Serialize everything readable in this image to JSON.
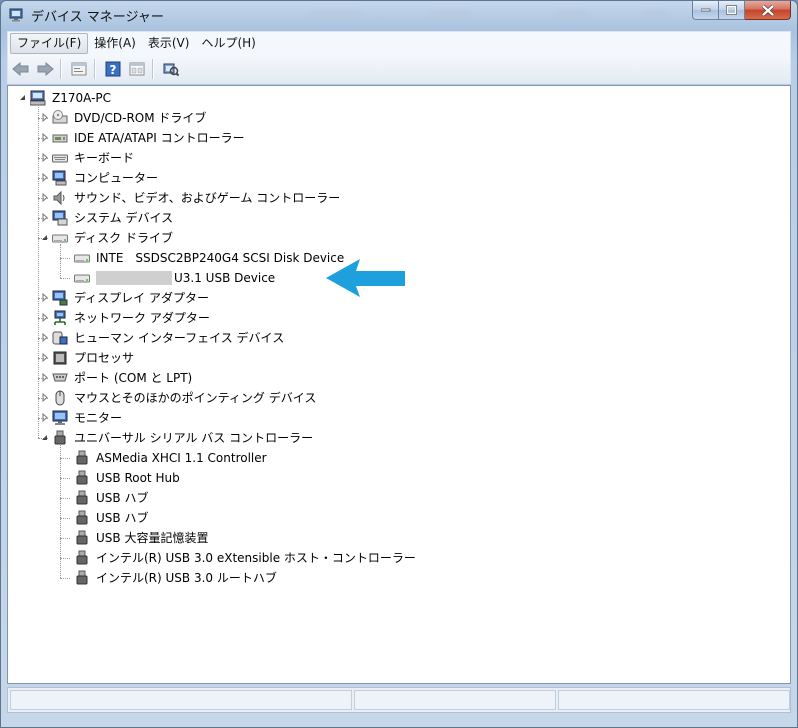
{
  "window": {
    "title": "デバイス マネージャー"
  },
  "menu": [
    {
      "label": "ファイル(F)",
      "name": "menu-file",
      "active": true
    },
    {
      "label": "操作(A)",
      "name": "menu-action"
    },
    {
      "label": "表示(V)",
      "name": "menu-view"
    },
    {
      "label": "ヘルプ(H)",
      "name": "menu-help"
    }
  ],
  "toolbar": [
    "back-icon",
    "forward-icon",
    "properties-icon",
    "help-icon",
    "show-hide-icon",
    "scan-hardware-icon"
  ],
  "tree": {
    "root": "Z170A-PC",
    "categories": [
      {
        "label": "DVD/CD-ROM ドライブ",
        "icon": "dvd-drive-icon",
        "expanded": false
      },
      {
        "label": "IDE ATA/ATAPI コントローラー",
        "icon": "ide-controller-icon",
        "expanded": false
      },
      {
        "label": "キーボード",
        "icon": "keyboard-icon",
        "expanded": false
      },
      {
        "label": "コンピューター",
        "icon": "computer-icon",
        "expanded": false
      },
      {
        "label": "サウンド、ビデオ、およびゲーム コントローラー",
        "icon": "sound-icon",
        "expanded": false
      },
      {
        "label": "システム デバイス",
        "icon": "system-device-icon",
        "expanded": false
      },
      {
        "label": "ディスク ドライブ",
        "icon": "disk-drive-icon",
        "expanded": true,
        "children": [
          {
            "label": "INTE　SSDSC2BP240G4 SCSI Disk Device",
            "icon": "disk-drive-icon"
          },
          {
            "label": "U3.1 USB Device",
            "icon": "disk-drive-icon",
            "redacted": true
          }
        ]
      },
      {
        "label": "ディスプレイ アダプター",
        "icon": "display-adapter-icon",
        "expanded": false
      },
      {
        "label": "ネットワーク アダプター",
        "icon": "network-adapter-icon",
        "expanded": false
      },
      {
        "label": "ヒューマン インターフェイス デバイス",
        "icon": "hid-icon",
        "expanded": false
      },
      {
        "label": "プロセッサ",
        "icon": "processor-icon",
        "expanded": false
      },
      {
        "label": "ポート (COM と LPT)",
        "icon": "port-icon",
        "expanded": false
      },
      {
        "label": "マウスとそのほかのポインティング デバイス",
        "icon": "mouse-icon",
        "expanded": false
      },
      {
        "label": "モニター",
        "icon": "monitor-icon",
        "expanded": false
      },
      {
        "label": "ユニバーサル シリアル バス コントローラー",
        "icon": "usb-controller-icon",
        "expanded": true,
        "children": [
          {
            "label": "ASMedia XHCI 1.1 Controller",
            "icon": "usb-icon"
          },
          {
            "label": "USB Root Hub",
            "icon": "usb-icon"
          },
          {
            "label": "USB ハブ",
            "icon": "usb-icon"
          },
          {
            "label": "USB ハブ",
            "icon": "usb-icon"
          },
          {
            "label": "USB 大容量記憶装置",
            "icon": "usb-icon"
          },
          {
            "label": "インテル(R) USB 3.0 eXtensible ホスト・コントローラー",
            "icon": "usb-icon"
          },
          {
            "label": "インテル(R) USB 3.0 ルートハブ",
            "icon": "usb-icon"
          }
        ]
      }
    ]
  },
  "annotation": {
    "icon": "arrow-left-icon",
    "color": "#1ea0dc"
  }
}
